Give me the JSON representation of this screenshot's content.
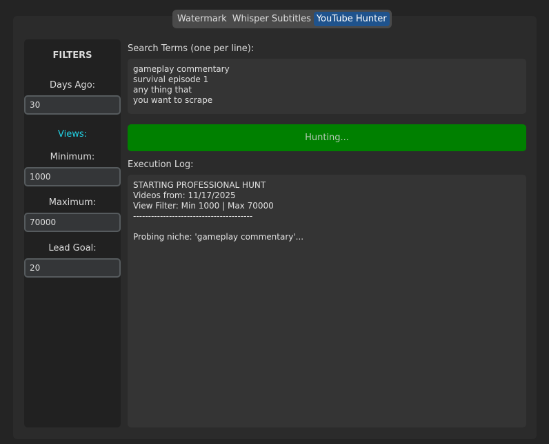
{
  "tabs": [
    {
      "label": "Watermark",
      "active": false
    },
    {
      "label": "Whisper Subtitles",
      "active": false
    },
    {
      "label": "YouTube Hunter",
      "active": true
    }
  ],
  "sidebar": {
    "title": "FILTERS",
    "days_ago_label": "Days Ago:",
    "days_ago_value": "30",
    "views_label": "Views:",
    "minimum_label": "Minimum:",
    "minimum_value": "1000",
    "maximum_label": "Maximum:",
    "maximum_value": "70000",
    "lead_goal_label": "Lead Goal:",
    "lead_goal_value": "20"
  },
  "main": {
    "search_terms_label": "Search Terms (one per line):",
    "search_terms": "gameplay commentary\nsurvival episode 1\nany thing that\nyou want to scrape",
    "hunt_button_label": "Hunting...",
    "log_label": "Execution Log:",
    "log_text": "STARTING PROFESSIONAL HUNT\nVideos from: 11/17/2025\nView Filter: Min 1000 | Max 70000\n----------------------------------------\n\nProbing niche: 'gameplay commentary'..."
  },
  "colors": {
    "background": "#242424",
    "panel": "#2b2b2b",
    "sidebar": "#212121",
    "active_tab": "#1f538d",
    "accent_cyan": "#22d3e6",
    "hunt_button": "#008000"
  }
}
